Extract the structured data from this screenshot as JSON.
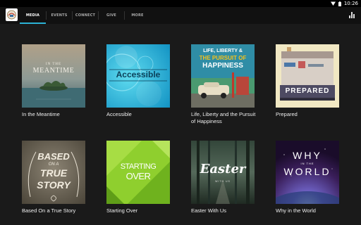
{
  "status": {
    "time": "10:26"
  },
  "tabs": [
    "MEDIA",
    "EVENTS",
    "CONNECT",
    "GIVE",
    "MORE"
  ],
  "active_tab": "MEDIA",
  "series": [
    {
      "title": "In the Meantime",
      "art_top": "IN THE",
      "art_main": "MEANTIME"
    },
    {
      "title": "Accessible",
      "art_main": "Accessible"
    },
    {
      "title": "Life, Liberty and the Pursuit of Happiness",
      "art_top": "LIFE, LIBERTY &",
      "art_mid": "THE PURSUIT OF",
      "art_main": "HAPPINESS"
    },
    {
      "title": "Prepared",
      "art_main": "PREPARED"
    },
    {
      "title": "Based On a True Story",
      "art_top": "BASED",
      "art_mid": "ON A",
      "art_main": "TRUE",
      "art_bottom": "STORY"
    },
    {
      "title": "Starting Over",
      "art_top": "STARTING",
      "art_main": "OVER"
    },
    {
      "title": "Easter With Us",
      "art_main": "Easter",
      "art_sub": "WITH US"
    },
    {
      "title": "Why in the World",
      "art_top": "WHY",
      "art_mid": "IN THE",
      "art_main": "WORLD"
    }
  ],
  "colors": {
    "accent": "#2bb3d6",
    "background": "#1a1a1a",
    "appbar": "#111111"
  },
  "icons": {
    "wifi": "wifi-icon",
    "battery": "battery-icon",
    "analytics": "analytics-icon"
  }
}
